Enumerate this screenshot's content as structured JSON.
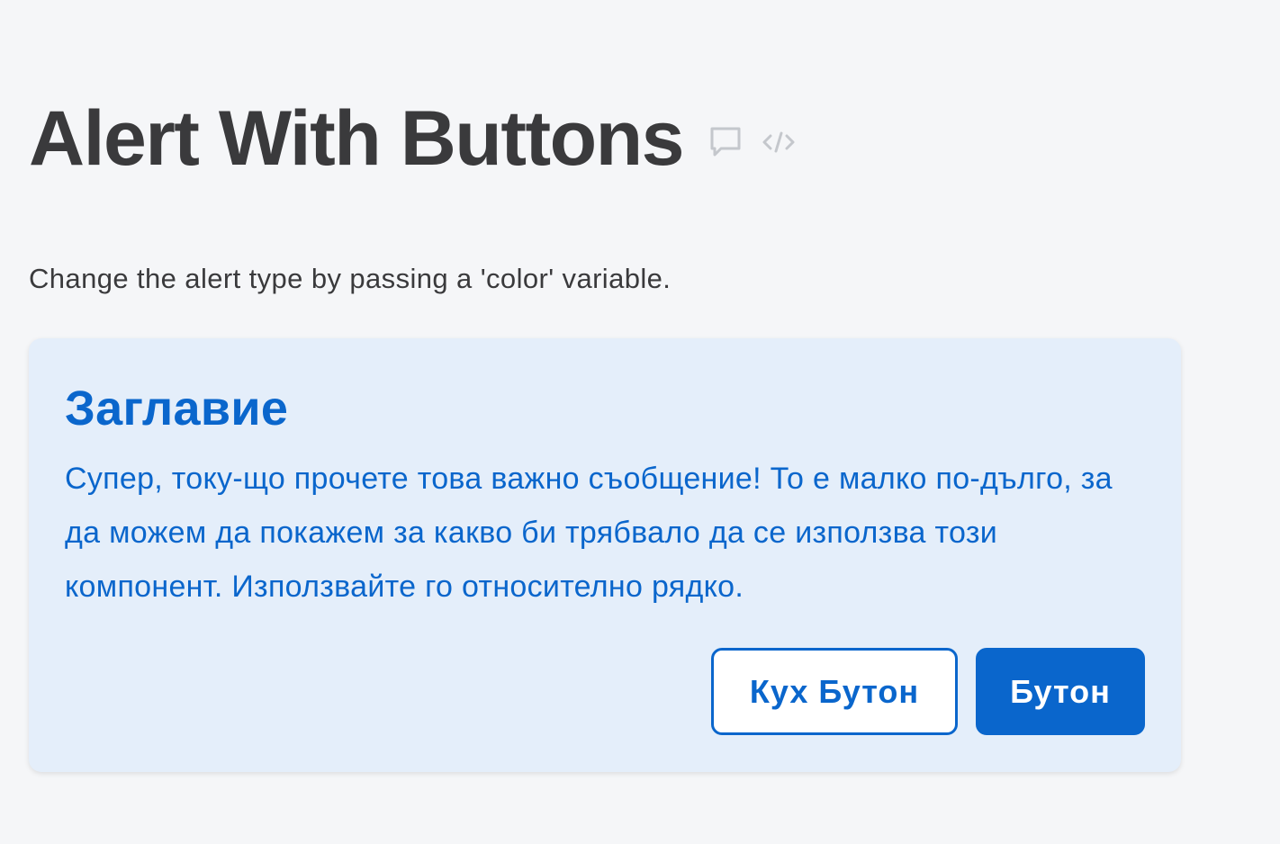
{
  "page": {
    "title": "Alert With Buttons",
    "description": "Change the alert type by passing a 'color' variable.",
    "icons": {
      "comment": "comment-icon",
      "code": "code-icon"
    }
  },
  "alert": {
    "title": "Заглавие",
    "body": "Супер, току-що прочете това важно съобщение! То е малко по-дълго, за да можем да покажем за какво би трябвало да се използва този компонент. Използвайте го относително рядко.",
    "secondary_button_label": "Кух Бутон",
    "primary_button_label": "Бутон"
  },
  "colors": {
    "background": "#f5f6f8",
    "alert_background": "#e4eefa",
    "accent": "#0a66cc",
    "heading_text": "#3a3a3c",
    "icon": "#c4c7cc"
  }
}
